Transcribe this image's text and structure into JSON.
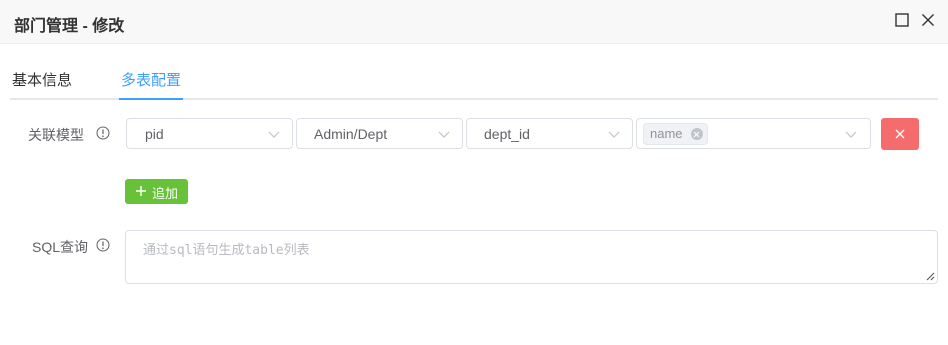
{
  "dialog": {
    "title": "部门管理 - 修改"
  },
  "tabs": [
    {
      "label": "基本信息",
      "active": false
    },
    {
      "label": "多表配置",
      "active": true
    }
  ],
  "relation": {
    "label": "关联模型",
    "selects": [
      {
        "value": "pid"
      },
      {
        "value": "Admin/Dept"
      },
      {
        "value": "dept_id"
      }
    ],
    "field_tags": [
      "name"
    ],
    "add_label": "追加"
  },
  "sql": {
    "label": "SQL查询",
    "value": "",
    "placeholder": "通过sql语句生成table列表"
  },
  "colors": {
    "primary": "#409eff",
    "success": "#67c23a",
    "danger": "#f56c6c",
    "border": "#dcdfe6"
  },
  "icons": {
    "maximize": "square-icon",
    "close": "x-icon",
    "info": "info-circle-icon",
    "dropdown": "chevron-down-icon",
    "add": "plus-icon"
  }
}
